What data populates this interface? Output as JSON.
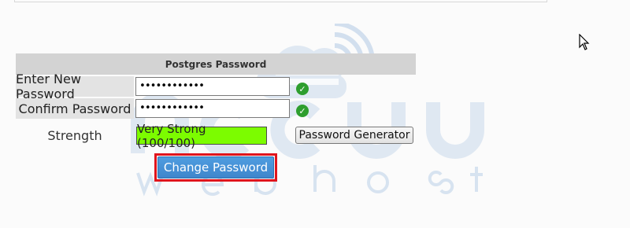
{
  "form": {
    "header": "Postgres Password",
    "new_password_label": "Enter New Password",
    "new_password_value": "••••••••••••",
    "confirm_password_label": "Confirm Password",
    "confirm_password_value": "••••••••••••",
    "strength_label": "Strength",
    "strength_value": "Very Strong (100/100)",
    "generator_label": "Password Generator",
    "submit_label": "Change Password"
  },
  "status_icons": {
    "new_password_check": "check-circle-icon",
    "confirm_password_check": "check-circle-icon"
  },
  "colors": {
    "header_bg": "#d3d3d3",
    "strength_bg": "#7cfc00",
    "submit_bg": "#428fd6",
    "highlight_border": "#e0141c",
    "check_green": "#2e9e2e"
  }
}
